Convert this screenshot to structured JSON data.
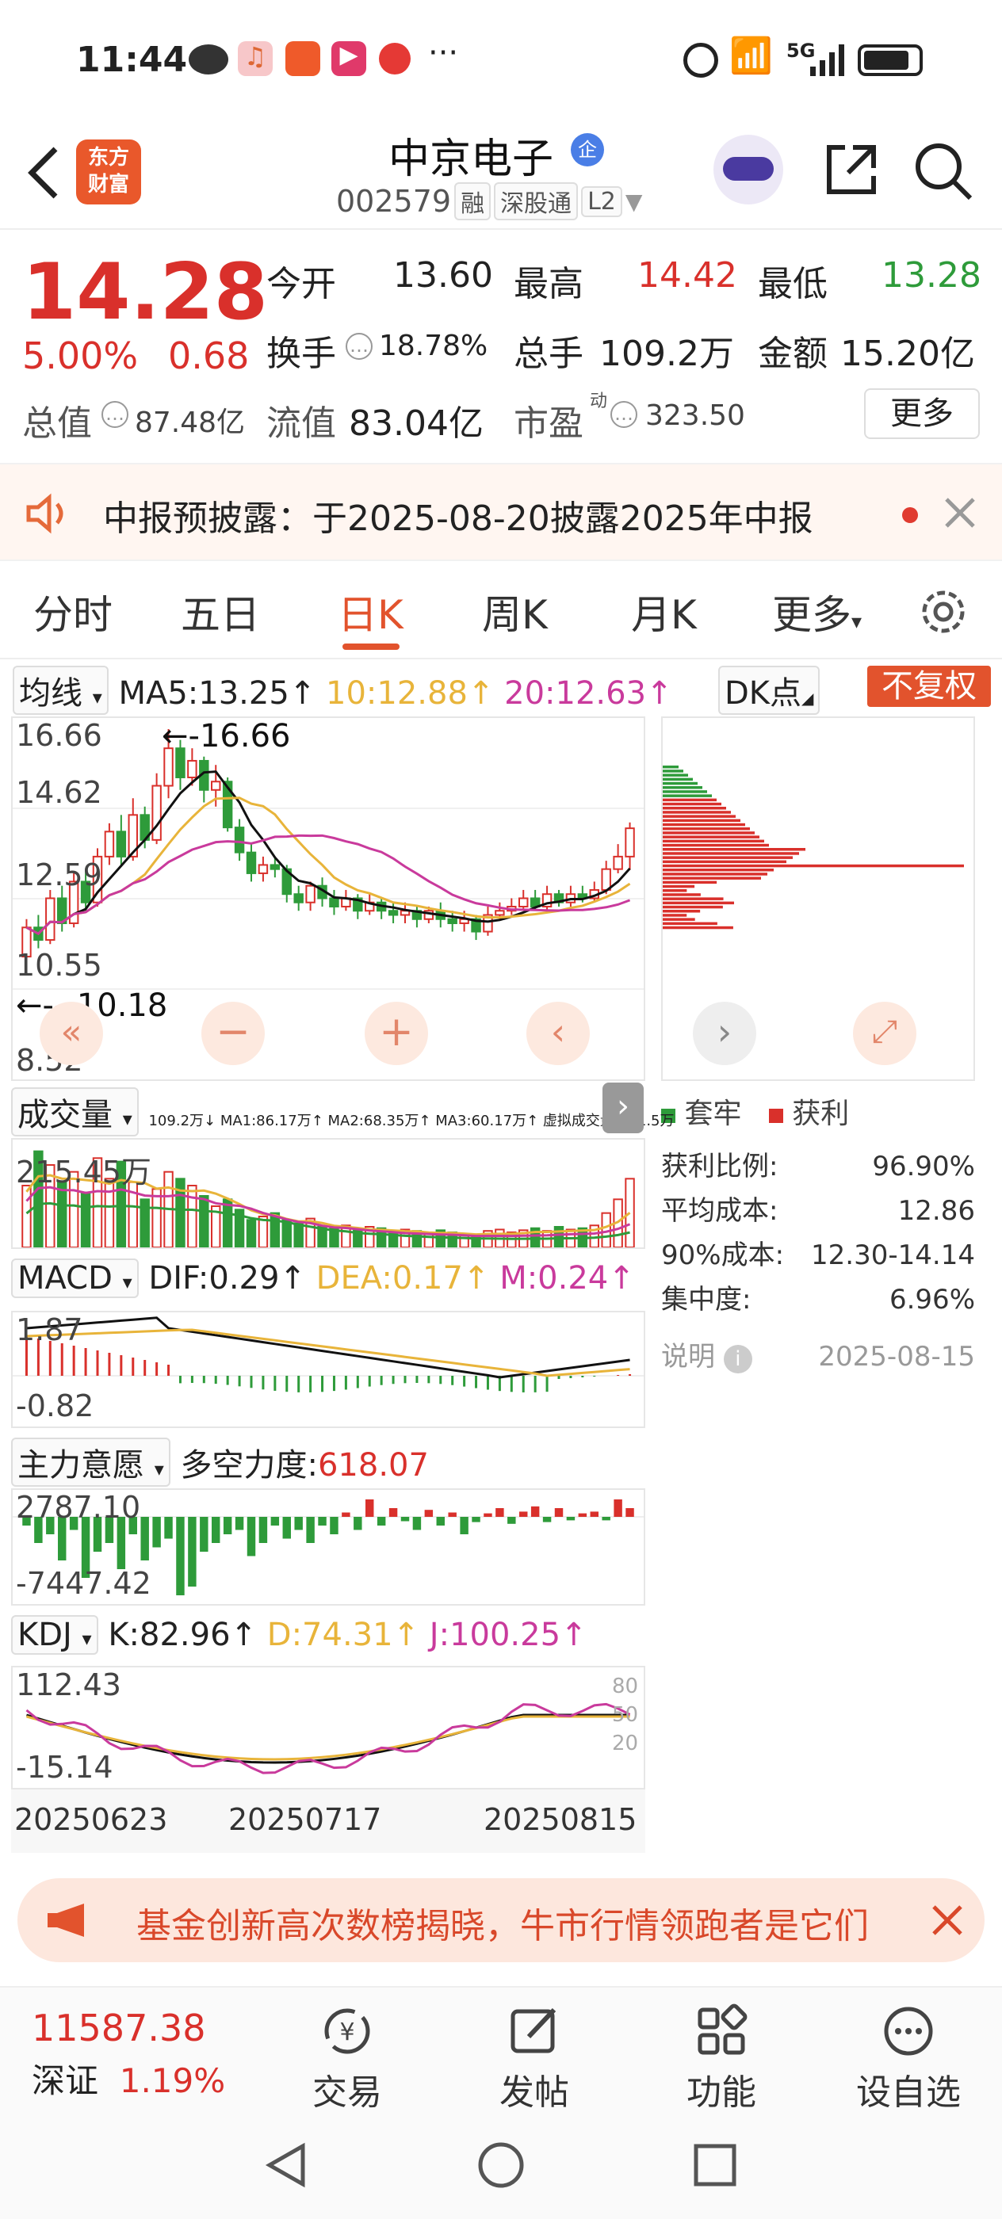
{
  "status_bar": {
    "time": "11:44",
    "network": "5G"
  },
  "header": {
    "logo_line1": "东方",
    "logo_line2": "财富",
    "stock_name": "中京电子",
    "badge": "企",
    "stock_code": "002579",
    "tags": [
      "融",
      "深股通",
      "L2"
    ]
  },
  "quote": {
    "price": "14.28",
    "change_pct": "5.00%",
    "change": "0.68",
    "open_label": "今开",
    "open": "13.60",
    "high_label": "最高",
    "high": "14.42",
    "low_label": "最低",
    "low": "13.28",
    "turnover_label": "换手",
    "turnover": "18.78%",
    "volume_label": "总手",
    "volume": "109.2万",
    "amount_label": "金额",
    "amount": "15.20亿",
    "mktcap_label": "总值",
    "mktcap": "87.48亿",
    "float_label": "流值",
    "float": "83.04亿",
    "pe_label": "市盈",
    "pe_sup": "动",
    "pe": "323.50",
    "more_label": "更多"
  },
  "notice": {
    "text": "中报预披露：于2025-08-20披露2025年中报"
  },
  "tabs": [
    "分时",
    "五日",
    "日K",
    "周K",
    "月K",
    "更多"
  ],
  "active_tab": 2,
  "kline": {
    "ma_selector": "均线",
    "ma5": "MA5:13.25↑",
    "ma10": "10:12.88↑",
    "ma20": "20:12.63↑",
    "dk_label": "DK点",
    "adjust_label": "不复权",
    "y_labels": [
      "16.66",
      "14.62",
      "12.59",
      "10.55",
      "8.52"
    ],
    "max_mark": "←-16.66",
    "min_mark": "←---10.18",
    "colors": {
      "ma5": "#111111",
      "ma10": "#e8b43a",
      "ma20": "#c93a9c",
      "up": "#d9302b",
      "down": "#2e9b3a"
    }
  },
  "volume": {
    "selector": "成交量",
    "values_line": "109.2万↓ MA1:86.17万↑ MA2:68.35万↑ MA3:60.17万↑ 虚拟成交量:241.5万",
    "y_label": "215.45万"
  },
  "macd": {
    "selector": "MACD",
    "dif": "DIF:0.29↑",
    "dea": "DEA:0.17↑",
    "m": "M:0.24↑",
    "y_top": "1.87",
    "y_bottom": "-0.82"
  },
  "force": {
    "selector": "主力意愿",
    "label": "多空力度:",
    "value": "618.07",
    "y_top": "2787.10",
    "y_bottom": "-7447.42"
  },
  "kdj": {
    "selector": "KDJ",
    "k": "K:82.96↑",
    "d": "D:74.31↑",
    "j": "J:100.25↑",
    "y_top": "112.43",
    "y_bottom": "-15.14",
    "levels": [
      "80",
      "50",
      "20"
    ]
  },
  "x_dates": [
    "20250623",
    "20250717",
    "20250815"
  ],
  "chip": {
    "legend": [
      "套牢",
      "获利"
    ],
    "rows": [
      {
        "label": "获利比例:",
        "value": "96.90%"
      },
      {
        "label": "平均成本:",
        "value": "12.86"
      },
      {
        "label": "90%成本:",
        "value": "12.30-14.14"
      },
      {
        "label": "集中度:",
        "value": "6.96%"
      }
    ],
    "note_label": "说明",
    "date": "2025-08-15"
  },
  "ad": {
    "text": "基金创新高次数榜揭晓，牛市行情领跑者是它们"
  },
  "bottom_nav": {
    "index_value": "11587.38",
    "index_name": "深证",
    "index_pct": "1.19%",
    "items": [
      "交易",
      "发帖",
      "功能",
      "设自选"
    ]
  }
}
